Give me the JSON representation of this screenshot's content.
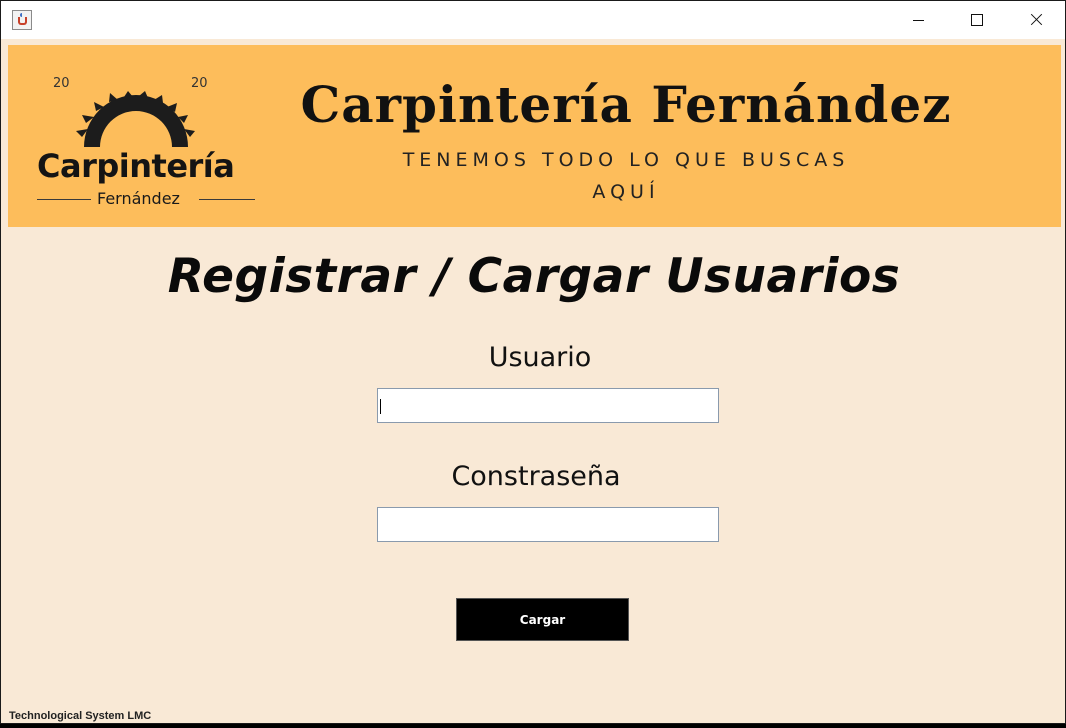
{
  "window": {
    "app_icon": "java-coffee-icon",
    "controls": [
      "minimize-icon",
      "maximize-icon",
      "close-icon"
    ]
  },
  "banner": {
    "logo": {
      "year_left": "20",
      "year_right": "20",
      "name": "Carpintería",
      "subtitle": "Fernández",
      "icon": "saw-blade-icon"
    },
    "title": "Carpintería Fernández",
    "tagline_line1": "TENEMOS TODO LO QUE BUSCAS",
    "tagline_line2": "AQUÍ"
  },
  "form": {
    "heading": "Registrar / Cargar Usuarios",
    "user_label": "Usuario",
    "user_value": "",
    "password_label": "Constraseña",
    "password_value": "",
    "submit_label": "Cargar"
  },
  "footer": {
    "text": "Technological System LMC"
  },
  "colors": {
    "banner_bg": "#fdbd5b",
    "page_bg": "#f9e9d6",
    "button_bg": "#000000",
    "button_text": "#ffffff"
  }
}
